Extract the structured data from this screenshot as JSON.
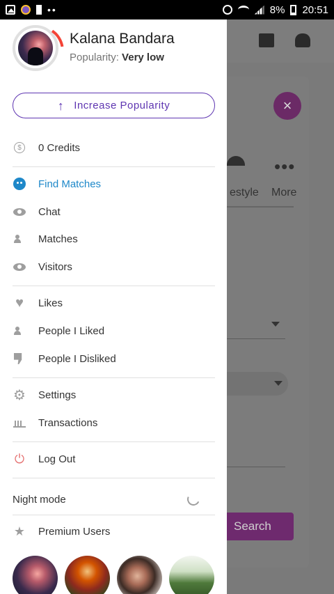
{
  "status_bar": {
    "battery": "8%",
    "time": "20:51",
    "dots": "••"
  },
  "background": {
    "tab_lifestyle": "estyle",
    "tab_more": "More",
    "close_symbol": "×",
    "more_dots": "•••",
    "search_label": "Search"
  },
  "profile": {
    "name": "Kalana Bandara",
    "popularity_label": "Popularity:",
    "popularity_value": "Very low"
  },
  "increase_button": {
    "label": "Increase Popularity",
    "arrow": "↑"
  },
  "menu": {
    "credits": "0 Credits",
    "find_matches": "Find Matches",
    "chat": "Chat",
    "matches": "Matches",
    "visitors": "Visitors",
    "likes": "Likes",
    "people_liked": "People I Liked",
    "people_disliked": "People I Disliked",
    "settings": "Settings",
    "transactions": "Transactions",
    "logout": "Log Out",
    "night_mode": "Night mode",
    "premium_users": "Premium Users"
  },
  "icons": {
    "credit": "$",
    "heart": "♥",
    "gear": "⚙",
    "power": "⏻",
    "star": "★"
  },
  "colors": {
    "accent_purple": "#5e35b1",
    "active_blue": "#1e88c9",
    "logout_red": "#e57373",
    "brand_magenta": "#9c27b0"
  }
}
